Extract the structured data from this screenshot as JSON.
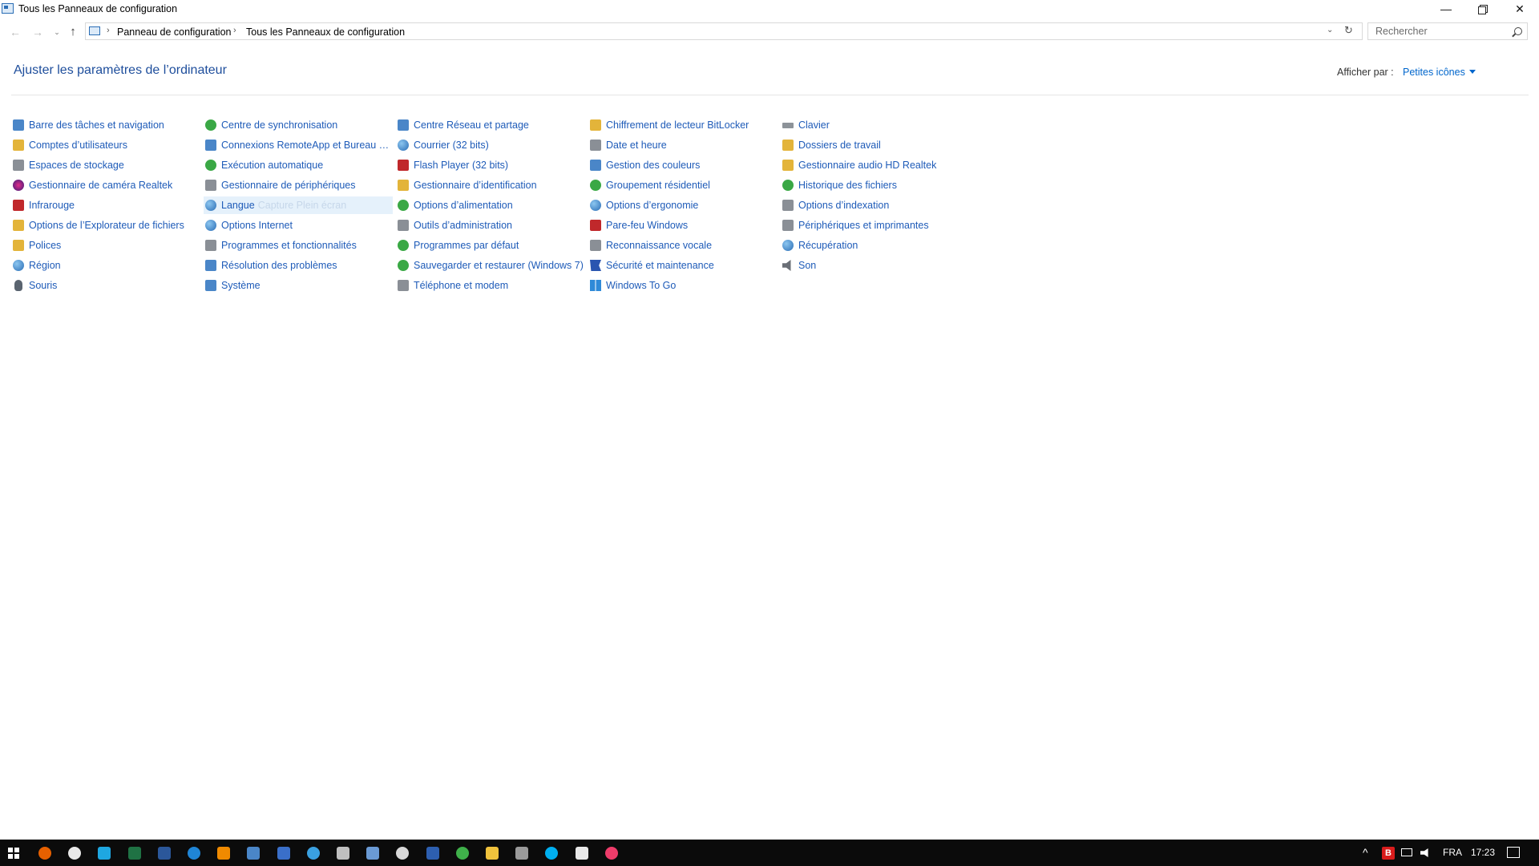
{
  "window": {
    "title": "Tous les Panneaux de configuration",
    "minimize": "—",
    "close": "✕"
  },
  "nav": {
    "back": "←",
    "forward": "→",
    "recent": "⌄",
    "up": "↑",
    "breadcrumb": [
      "Panneau de configuration",
      "Tous les Panneaux de configuration"
    ],
    "separator": "›",
    "dropdown": "⌄",
    "refresh": "↻"
  },
  "search": {
    "placeholder": "Rechercher"
  },
  "header": {
    "title": "Ajuster les paramètres de l’ordinateur",
    "view_by_label": "Afficher par :",
    "view_by_value": "Petites icônes"
  },
  "items": {
    "col1": [
      {
        "label": "Barre des tâches et navigation",
        "icon": "taskbar-icon",
        "color": "blue"
      },
      {
        "label": "Comptes d’utilisateurs",
        "icon": "users-icon",
        "color": "yellow"
      },
      {
        "label": "Espaces de stockage",
        "icon": "storage-icon",
        "color": "gray"
      },
      {
        "label": "Gestionnaire de caméra Realtek",
        "icon": "camera-icon",
        "color": "purple"
      },
      {
        "label": "Infrarouge",
        "icon": "infrared-icon",
        "color": "red"
      },
      {
        "label": "Options de l’Explorateur de fichiers",
        "icon": "folder-options-icon",
        "color": "yellow"
      },
      {
        "label": "Polices",
        "icon": "fonts-icon",
        "color": "yellow"
      },
      {
        "label": "Région",
        "icon": "region-icon",
        "color": "globe"
      },
      {
        "label": "Souris",
        "icon": "mouse-icon",
        "color": "mono"
      }
    ],
    "col2": [
      {
        "label": "Centre de synchronisation",
        "icon": "sync-icon",
        "color": "green"
      },
      {
        "label": "Connexions RemoteApp et Bureau à ...",
        "icon": "remoteapp-icon",
        "color": "blue"
      },
      {
        "label": "Exécution automatique",
        "icon": "autoplay-icon",
        "color": "green"
      },
      {
        "label": "Gestionnaire de périphériques",
        "icon": "device-manager-icon",
        "color": "gray"
      },
      {
        "label": "Langue",
        "icon": "language-icon",
        "color": "globe",
        "ghost": "Capture Plein écran"
      },
      {
        "label": "Options Internet",
        "icon": "internet-options-icon",
        "color": "globe"
      },
      {
        "label": "Programmes et fonctionnalités",
        "icon": "programs-icon",
        "color": "gray"
      },
      {
        "label": "Résolution des problèmes",
        "icon": "troubleshoot-icon",
        "color": "blue"
      },
      {
        "label": "Système",
        "icon": "system-icon",
        "color": "blue"
      }
    ],
    "col3": [
      {
        "label": "Centre Réseau et partage",
        "icon": "network-icon",
        "color": "blue"
      },
      {
        "label": "Courrier (32 bits)",
        "icon": "mail-icon",
        "color": "globe"
      },
      {
        "label": "Flash Player (32 bits)",
        "icon": "flash-icon",
        "color": "red"
      },
      {
        "label": "Gestionnaire d’identification",
        "icon": "credential-icon",
        "color": "yellow"
      },
      {
        "label": "Options d’alimentation",
        "icon": "power-icon",
        "color": "green"
      },
      {
        "label": "Outils d’administration",
        "icon": "admin-tools-icon",
        "color": "gray"
      },
      {
        "label": "Programmes par défaut",
        "icon": "default-programs-icon",
        "color": "green"
      },
      {
        "label": "Sauvegarder et restaurer (Windows 7)",
        "icon": "backup-icon",
        "color": "green"
      },
      {
        "label": "Téléphone et modem",
        "icon": "phone-modem-icon",
        "color": "gray"
      }
    ],
    "col4": [
      {
        "label": "Chiffrement de lecteur BitLocker",
        "icon": "bitlocker-icon",
        "color": "yellow"
      },
      {
        "label": "Date et heure",
        "icon": "datetime-icon",
        "color": "gray"
      },
      {
        "label": "Gestion des couleurs",
        "icon": "color-management-icon",
        "color": "blue"
      },
      {
        "label": "Groupement résidentiel",
        "icon": "homegroup-icon",
        "color": "green"
      },
      {
        "label": "Options d’ergonomie",
        "icon": "ease-of-access-icon",
        "color": "globe"
      },
      {
        "label": "Pare-feu Windows",
        "icon": "firewall-icon",
        "color": "red"
      },
      {
        "label": "Reconnaissance vocale",
        "icon": "speech-icon",
        "color": "gray"
      },
      {
        "label": "Sécurité et maintenance",
        "icon": "security-flag-icon",
        "color": "flag"
      },
      {
        "label": "Windows To Go",
        "icon": "windows-to-go-icon",
        "color": "win"
      }
    ],
    "col5": [
      {
        "label": "Clavier",
        "icon": "keyboard-icon",
        "color": "kbd"
      },
      {
        "label": "Dossiers de travail",
        "icon": "work-folders-icon",
        "color": "yellow"
      },
      {
        "label": "Gestionnaire audio HD Realtek",
        "icon": "realtek-audio-icon",
        "color": "yellow"
      },
      {
        "label": "Historique des fichiers",
        "icon": "file-history-icon",
        "color": "green"
      },
      {
        "label": "Options d’indexation",
        "icon": "indexing-icon",
        "color": "gray"
      },
      {
        "label": "Périphériques et imprimantes",
        "icon": "devices-printers-icon",
        "color": "gray"
      },
      {
        "label": "Récupération",
        "icon": "recovery-icon",
        "color": "globe"
      },
      {
        "label": "Son",
        "icon": "sound-icon",
        "color": "speaker"
      }
    ]
  },
  "taskbar": {
    "apps": [
      {
        "name": "firefox-icon",
        "color": "#e66000"
      },
      {
        "name": "chrome-icon",
        "color": "#e8e8e8"
      },
      {
        "name": "ie-icon",
        "color": "#1ea7e1"
      },
      {
        "name": "excel-icon",
        "color": "#1f7244"
      },
      {
        "name": "word-icon",
        "color": "#2b579a"
      },
      {
        "name": "edge-icon",
        "color": "#1f85d6"
      },
      {
        "name": "vlc-icon",
        "color": "#f08a00"
      },
      {
        "name": "control-panel-icon",
        "color": "#4a86c8"
      },
      {
        "name": "app-icon-9",
        "color": "#3a6fc9"
      },
      {
        "name": "app-icon-10",
        "color": "#3aa0e0"
      },
      {
        "name": "app-icon-11",
        "color": "#bfbfbf"
      },
      {
        "name": "app-icon-12",
        "color": "#6a9ad4"
      },
      {
        "name": "app-icon-13",
        "color": "#d8d8d8"
      },
      {
        "name": "app-icon-14",
        "color": "#2d5fb0"
      },
      {
        "name": "app-icon-15",
        "color": "#3fb04a"
      },
      {
        "name": "file-explorer-icon",
        "color": "#f0c23c"
      },
      {
        "name": "app-icon-17",
        "color": "#9a9a9a"
      },
      {
        "name": "skype-icon",
        "color": "#00aff0"
      },
      {
        "name": "store-icon",
        "color": "#e8e8e8"
      },
      {
        "name": "itunes-icon",
        "color": "#ee3c6a"
      }
    ],
    "tray": {
      "chevron": "^",
      "badge": "B",
      "language": "FRA",
      "time": "17:23"
    }
  }
}
